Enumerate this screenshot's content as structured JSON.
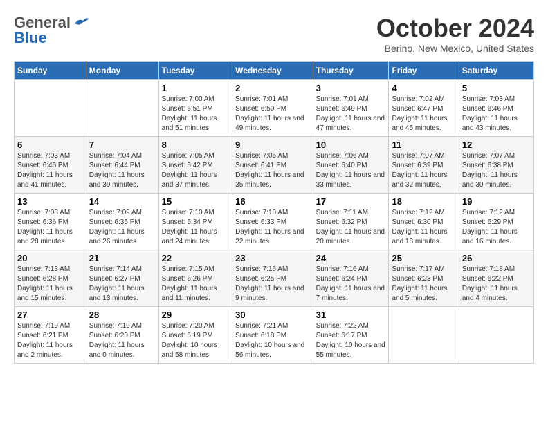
{
  "header": {
    "logo_general": "General",
    "logo_blue": "Blue",
    "month_title": "October 2024",
    "location": "Berino, New Mexico, United States"
  },
  "weekdays": [
    "Sunday",
    "Monday",
    "Tuesday",
    "Wednesday",
    "Thursday",
    "Friday",
    "Saturday"
  ],
  "weeks": [
    [
      {
        "day": "",
        "sunrise": "",
        "sunset": "",
        "daylight": ""
      },
      {
        "day": "",
        "sunrise": "",
        "sunset": "",
        "daylight": ""
      },
      {
        "day": "1",
        "sunrise": "Sunrise: 7:00 AM",
        "sunset": "Sunset: 6:51 PM",
        "daylight": "Daylight: 11 hours and 51 minutes."
      },
      {
        "day": "2",
        "sunrise": "Sunrise: 7:01 AM",
        "sunset": "Sunset: 6:50 PM",
        "daylight": "Daylight: 11 hours and 49 minutes."
      },
      {
        "day": "3",
        "sunrise": "Sunrise: 7:01 AM",
        "sunset": "Sunset: 6:49 PM",
        "daylight": "Daylight: 11 hours and 47 minutes."
      },
      {
        "day": "4",
        "sunrise": "Sunrise: 7:02 AM",
        "sunset": "Sunset: 6:47 PM",
        "daylight": "Daylight: 11 hours and 45 minutes."
      },
      {
        "day": "5",
        "sunrise": "Sunrise: 7:03 AM",
        "sunset": "Sunset: 6:46 PM",
        "daylight": "Daylight: 11 hours and 43 minutes."
      }
    ],
    [
      {
        "day": "6",
        "sunrise": "Sunrise: 7:03 AM",
        "sunset": "Sunset: 6:45 PM",
        "daylight": "Daylight: 11 hours and 41 minutes."
      },
      {
        "day": "7",
        "sunrise": "Sunrise: 7:04 AM",
        "sunset": "Sunset: 6:44 PM",
        "daylight": "Daylight: 11 hours and 39 minutes."
      },
      {
        "day": "8",
        "sunrise": "Sunrise: 7:05 AM",
        "sunset": "Sunset: 6:42 PM",
        "daylight": "Daylight: 11 hours and 37 minutes."
      },
      {
        "day": "9",
        "sunrise": "Sunrise: 7:05 AM",
        "sunset": "Sunset: 6:41 PM",
        "daylight": "Daylight: 11 hours and 35 minutes."
      },
      {
        "day": "10",
        "sunrise": "Sunrise: 7:06 AM",
        "sunset": "Sunset: 6:40 PM",
        "daylight": "Daylight: 11 hours and 33 minutes."
      },
      {
        "day": "11",
        "sunrise": "Sunrise: 7:07 AM",
        "sunset": "Sunset: 6:39 PM",
        "daylight": "Daylight: 11 hours and 32 minutes."
      },
      {
        "day": "12",
        "sunrise": "Sunrise: 7:07 AM",
        "sunset": "Sunset: 6:38 PM",
        "daylight": "Daylight: 11 hours and 30 minutes."
      }
    ],
    [
      {
        "day": "13",
        "sunrise": "Sunrise: 7:08 AM",
        "sunset": "Sunset: 6:36 PM",
        "daylight": "Daylight: 11 hours and 28 minutes."
      },
      {
        "day": "14",
        "sunrise": "Sunrise: 7:09 AM",
        "sunset": "Sunset: 6:35 PM",
        "daylight": "Daylight: 11 hours and 26 minutes."
      },
      {
        "day": "15",
        "sunrise": "Sunrise: 7:10 AM",
        "sunset": "Sunset: 6:34 PM",
        "daylight": "Daylight: 11 hours and 24 minutes."
      },
      {
        "day": "16",
        "sunrise": "Sunrise: 7:10 AM",
        "sunset": "Sunset: 6:33 PM",
        "daylight": "Daylight: 11 hours and 22 minutes."
      },
      {
        "day": "17",
        "sunrise": "Sunrise: 7:11 AM",
        "sunset": "Sunset: 6:32 PM",
        "daylight": "Daylight: 11 hours and 20 minutes."
      },
      {
        "day": "18",
        "sunrise": "Sunrise: 7:12 AM",
        "sunset": "Sunset: 6:30 PM",
        "daylight": "Daylight: 11 hours and 18 minutes."
      },
      {
        "day": "19",
        "sunrise": "Sunrise: 7:12 AM",
        "sunset": "Sunset: 6:29 PM",
        "daylight": "Daylight: 11 hours and 16 minutes."
      }
    ],
    [
      {
        "day": "20",
        "sunrise": "Sunrise: 7:13 AM",
        "sunset": "Sunset: 6:28 PM",
        "daylight": "Daylight: 11 hours and 15 minutes."
      },
      {
        "day": "21",
        "sunrise": "Sunrise: 7:14 AM",
        "sunset": "Sunset: 6:27 PM",
        "daylight": "Daylight: 11 hours and 13 minutes."
      },
      {
        "day": "22",
        "sunrise": "Sunrise: 7:15 AM",
        "sunset": "Sunset: 6:26 PM",
        "daylight": "Daylight: 11 hours and 11 minutes."
      },
      {
        "day": "23",
        "sunrise": "Sunrise: 7:16 AM",
        "sunset": "Sunset: 6:25 PM",
        "daylight": "Daylight: 11 hours and 9 minutes."
      },
      {
        "day": "24",
        "sunrise": "Sunrise: 7:16 AM",
        "sunset": "Sunset: 6:24 PM",
        "daylight": "Daylight: 11 hours and 7 minutes."
      },
      {
        "day": "25",
        "sunrise": "Sunrise: 7:17 AM",
        "sunset": "Sunset: 6:23 PM",
        "daylight": "Daylight: 11 hours and 5 minutes."
      },
      {
        "day": "26",
        "sunrise": "Sunrise: 7:18 AM",
        "sunset": "Sunset: 6:22 PM",
        "daylight": "Daylight: 11 hours and 4 minutes."
      }
    ],
    [
      {
        "day": "27",
        "sunrise": "Sunrise: 7:19 AM",
        "sunset": "Sunset: 6:21 PM",
        "daylight": "Daylight: 11 hours and 2 minutes."
      },
      {
        "day": "28",
        "sunrise": "Sunrise: 7:19 AM",
        "sunset": "Sunset: 6:20 PM",
        "daylight": "Daylight: 11 hours and 0 minutes."
      },
      {
        "day": "29",
        "sunrise": "Sunrise: 7:20 AM",
        "sunset": "Sunset: 6:19 PM",
        "daylight": "Daylight: 10 hours and 58 minutes."
      },
      {
        "day": "30",
        "sunrise": "Sunrise: 7:21 AM",
        "sunset": "Sunset: 6:18 PM",
        "daylight": "Daylight: 10 hours and 56 minutes."
      },
      {
        "day": "31",
        "sunrise": "Sunrise: 7:22 AM",
        "sunset": "Sunset: 6:17 PM",
        "daylight": "Daylight: 10 hours and 55 minutes."
      },
      {
        "day": "",
        "sunrise": "",
        "sunset": "",
        "daylight": ""
      },
      {
        "day": "",
        "sunrise": "",
        "sunset": "",
        "daylight": ""
      }
    ]
  ]
}
